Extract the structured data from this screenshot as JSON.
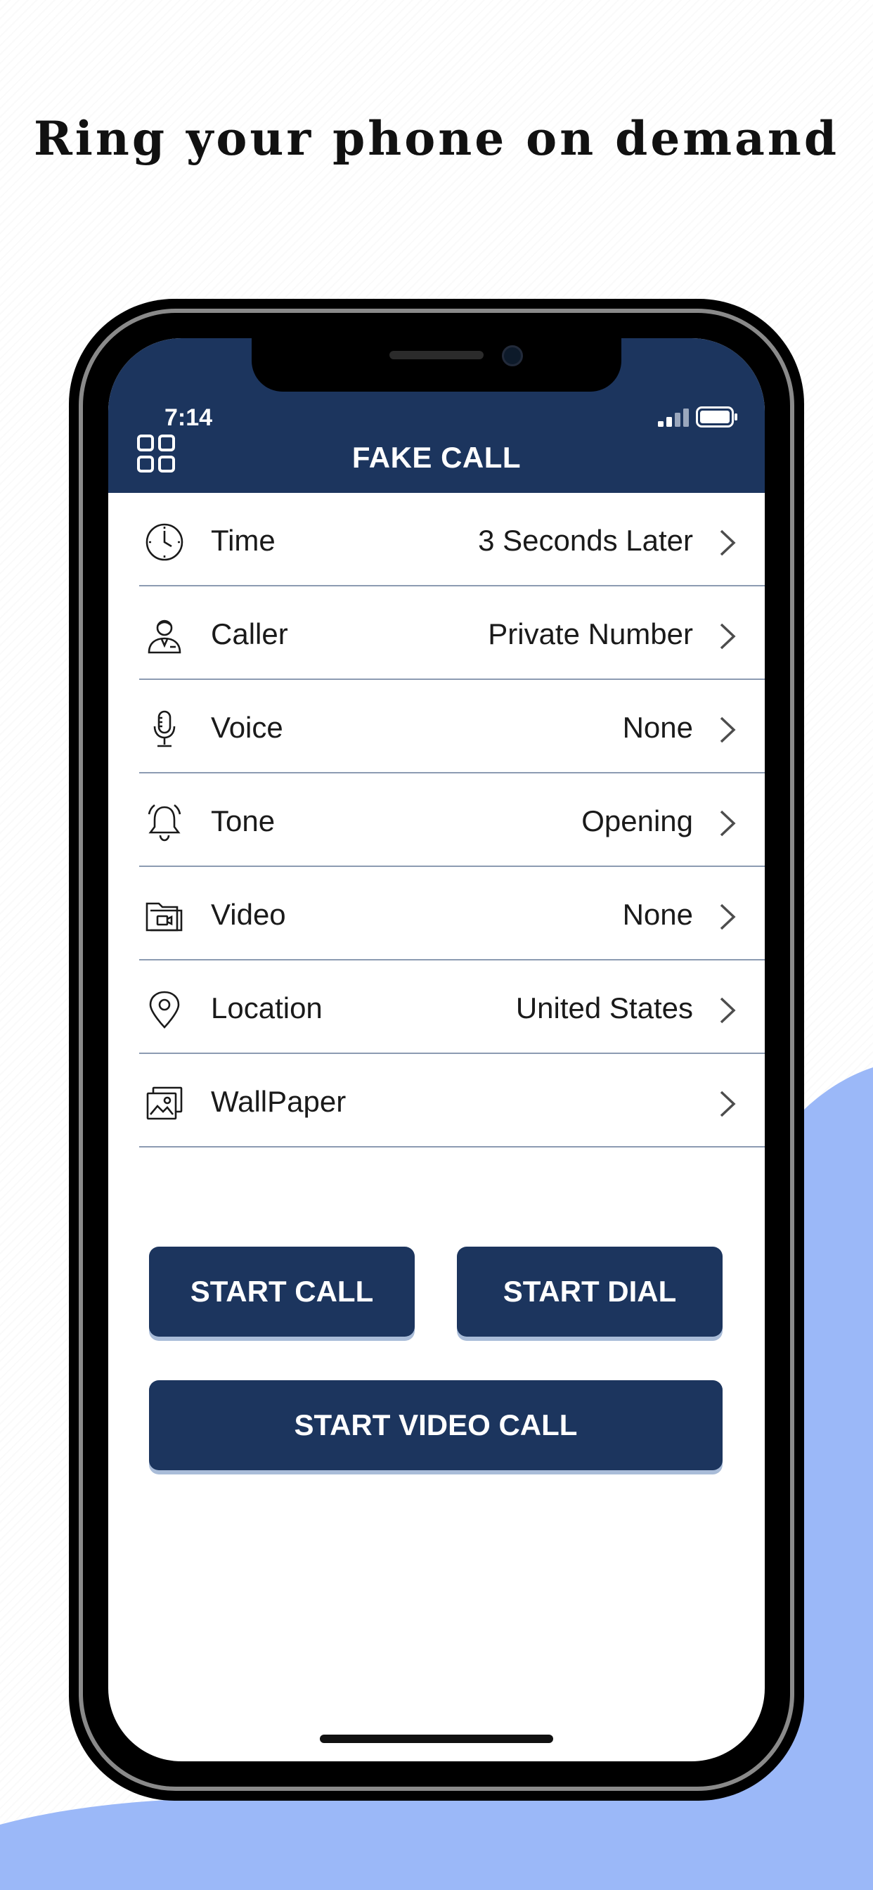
{
  "headline": "Ring your phone on demand",
  "colors": {
    "brand": "#1c355e",
    "background_blob": "#9bb8f8",
    "divider": "#8c9bb2"
  },
  "status_bar": {
    "time": "7:14",
    "signal_icon": "cellular-signal-icon",
    "battery_icon": "battery-icon"
  },
  "app_bar": {
    "title": "FAKE CALL",
    "menu_icon": "grid-menu-icon"
  },
  "settings": [
    {
      "icon": "clock-icon",
      "label": "Time",
      "value": "3 Seconds Later"
    },
    {
      "icon": "caller-person-icon",
      "label": "Caller",
      "value": "Private Number"
    },
    {
      "icon": "microphone-icon",
      "label": "Voice",
      "value": "None"
    },
    {
      "icon": "bell-icon",
      "label": "Tone",
      "value": "Opening"
    },
    {
      "icon": "video-folder-icon",
      "label": "Video",
      "value": "None"
    },
    {
      "icon": "location-pin-icon",
      "label": "Location",
      "value": "United States"
    },
    {
      "icon": "wallpaper-image-icon",
      "label": "WallPaper",
      "value": ""
    }
  ],
  "buttons": {
    "start_call": "START CALL",
    "start_dial": "START DIAL",
    "start_video_call": "START VIDEO CALL"
  }
}
